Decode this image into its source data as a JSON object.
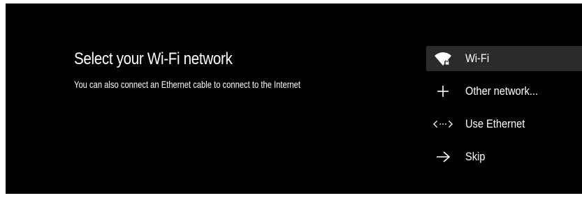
{
  "header": {
    "title": "Select your Wi-Fi network",
    "subtitle": "You can also connect an Ethernet cable to connect to the Internet"
  },
  "menu": {
    "items": [
      {
        "label": "Wi-Fi",
        "icon": "wifi-locked-icon",
        "selected": true
      },
      {
        "label": "Other network...",
        "icon": "plus-icon",
        "selected": false
      },
      {
        "label": "Use Ethernet",
        "icon": "ethernet-icon",
        "selected": false
      },
      {
        "label": "Skip",
        "icon": "arrow-right-icon",
        "selected": false
      }
    ]
  },
  "colors": {
    "background": "#000000",
    "selected_row": "#2b2b2b",
    "text": "#ffffff"
  }
}
